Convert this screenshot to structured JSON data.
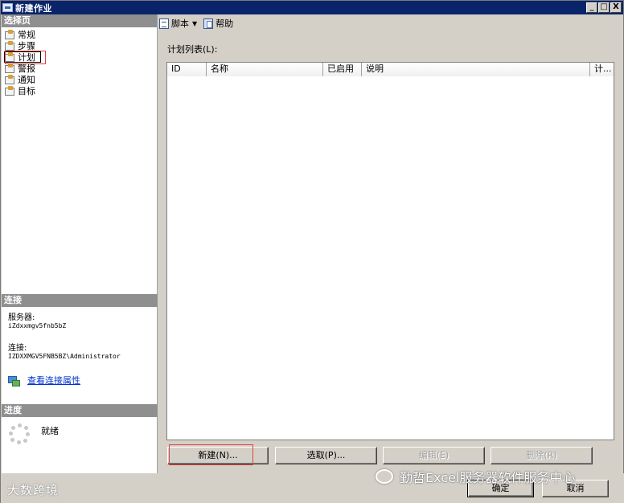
{
  "window": {
    "title": "新建作业",
    "minimize": "_",
    "maximize": "□",
    "close": "X"
  },
  "sidebar": {
    "header": "选择页",
    "items": [
      {
        "label": "常规"
      },
      {
        "label": "步骤"
      },
      {
        "label": "计划"
      },
      {
        "label": "警报"
      },
      {
        "label": "通知"
      },
      {
        "label": "目标"
      }
    ],
    "selected_index": 2
  },
  "connection": {
    "header": "连接",
    "server_label": "服务器:",
    "server_value": "iZdxxmgv5fnb5bZ",
    "conn_label": "连接:",
    "conn_value": "IZDXXMGV5FNB5BZ\\Administrator",
    "link_text": "查看连接属性"
  },
  "progress": {
    "header": "进度",
    "status": "就绪"
  },
  "toolbar": {
    "script_label": "脚本",
    "help_label": "帮助"
  },
  "schedule": {
    "list_label": "计划列表(L):",
    "columns": [
      "ID",
      "名称",
      "已启用",
      "说明",
      "计..."
    ],
    "rows": []
  },
  "buttons": {
    "new": "新建(N)...",
    "pick": "选取(P)...",
    "edit": "编辑(E)",
    "delete": "删除(R)",
    "ok": "确定",
    "cancel": "取消"
  },
  "watermarks": {
    "left": "大数跨境",
    "right": "勤哲Excel服务器软件服务中心"
  },
  "colors": {
    "titlebar": "#0a246a",
    "section_head": "#8f8f8f",
    "link": "#0033cc",
    "highlight": "#e0423e"
  }
}
